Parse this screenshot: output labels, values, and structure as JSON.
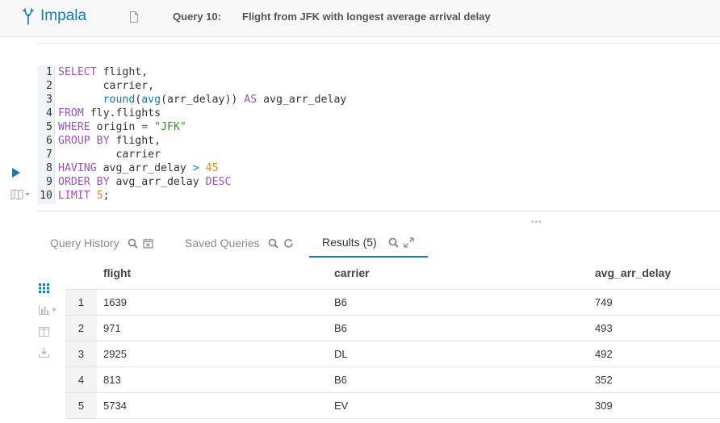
{
  "app": {
    "name": "Impala"
  },
  "query": {
    "number": "Query 10:",
    "name": "Flight from JFK with longest average arrival delay"
  },
  "editor": {
    "lines": [
      {
        "n": "1",
        "tokens": [
          [
            "kw",
            "SELECT"
          ],
          [
            "t",
            " flight,"
          ]
        ]
      },
      {
        "n": "2",
        "tokens": [
          [
            "t",
            "       carrier,"
          ]
        ]
      },
      {
        "n": "3",
        "tokens": [
          [
            "t",
            "       "
          ],
          [
            "fn",
            "round"
          ],
          [
            "t",
            "("
          ],
          [
            "fn",
            "avg"
          ],
          [
            "t",
            "(arr_delay)) "
          ],
          [
            "kw",
            "AS"
          ],
          [
            "t",
            " avg_arr_delay"
          ]
        ]
      },
      {
        "n": "4",
        "tokens": [
          [
            "kw",
            "FROM"
          ],
          [
            "t",
            " fly.flights"
          ]
        ]
      },
      {
        "n": "5",
        "tokens": [
          [
            "kw",
            "WHERE"
          ],
          [
            "t",
            " origin "
          ],
          [
            "op",
            "="
          ],
          [
            "t",
            " "
          ],
          [
            "str",
            "\"JFK\""
          ]
        ]
      },
      {
        "n": "6",
        "tokens": [
          [
            "kw",
            "GROUP BY"
          ],
          [
            "t",
            " flight,"
          ]
        ]
      },
      {
        "n": "7",
        "tokens": [
          [
            "t",
            "         carrier"
          ]
        ]
      },
      {
        "n": "8",
        "tokens": [
          [
            "kw",
            "HAVING"
          ],
          [
            "t",
            " avg_arr_delay "
          ],
          [
            "op",
            ">"
          ],
          [
            "t",
            " "
          ],
          [
            "num",
            "45"
          ]
        ]
      },
      {
        "n": "9",
        "tokens": [
          [
            "kw",
            "ORDER BY"
          ],
          [
            "t",
            " avg_arr_delay "
          ],
          [
            "kw",
            "DESC"
          ]
        ]
      },
      {
        "n": "10",
        "tokens": [
          [
            "kw",
            "LIMIT"
          ],
          [
            "t",
            " "
          ],
          [
            "num",
            "5"
          ],
          [
            "t",
            ";"
          ]
        ]
      }
    ]
  },
  "tabs": [
    {
      "label": "Query History",
      "icons": [
        "search-icon",
        "calendar-x-icon"
      ],
      "active": false
    },
    {
      "label": "Saved Queries",
      "icons": [
        "search-icon",
        "refresh-icon"
      ],
      "active": false
    },
    {
      "label": "Results (5)",
      "icons": [
        "search-icon",
        "expand-icon"
      ],
      "active": true
    }
  ],
  "results": {
    "columns": [
      "flight",
      "carrier",
      "avg_arr_delay"
    ],
    "rows": [
      [
        "1",
        "1639",
        "B6",
        "749"
      ],
      [
        "2",
        "971",
        "B6",
        "493"
      ],
      [
        "3",
        "2925",
        "DL",
        "492"
      ],
      [
        "4",
        "813",
        "B6",
        "352"
      ],
      [
        "5",
        "5734",
        "EV",
        "309"
      ]
    ]
  },
  "colors": {
    "accent": "#0b7fad",
    "keyword": "#9b53b8",
    "string": "#3a8a2e",
    "number": "#e08a1a"
  }
}
